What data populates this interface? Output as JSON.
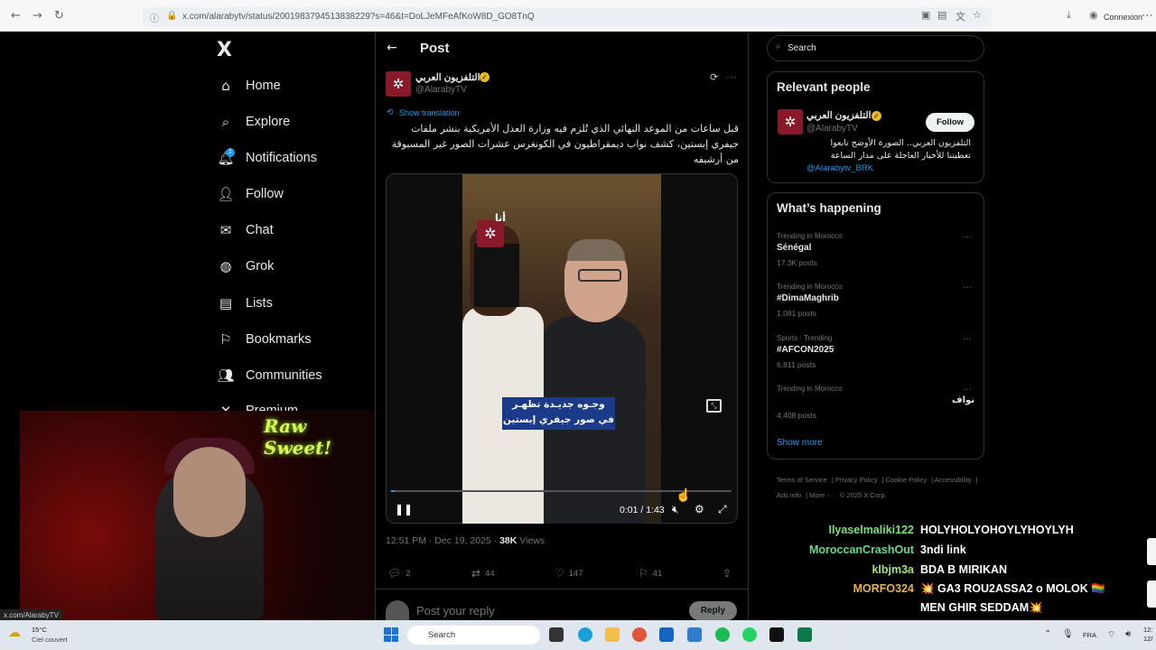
{
  "browser": {
    "url": "x.com/alarabytv/status/2001983794513838229?s=46&t=DoLJeMFeAfKoW8D_GO8TnQ",
    "connexion": "Connexion"
  },
  "nav": {
    "logo": "X",
    "items": [
      "Home",
      "Explore",
      "Notifications",
      "Follow",
      "Chat",
      "Grok",
      "Lists",
      "Bookmarks",
      "Communities",
      "Premium"
    ],
    "notif_badge": "1"
  },
  "webcam": {
    "sign_text": "Raw Sweet!",
    "status_url": "x.com/AlarabyTV"
  },
  "post": {
    "header_title": "Post",
    "author_name": "التلفزيون العربي",
    "author_handle": "@AlarabyTV",
    "show_translation": "Show translation",
    "text": "قبل ساعات من الموعد النهائي الذي تُلزم فيه وزارة العدل الأمريكية بنشر ملفات جيفري إبستين، كشف نواب ديمقراطيون في الكونغرس عشرات الصور غير المسبوقة من أرشيفه",
    "video": {
      "logo_tag": "أنا",
      "caption_line1": "وجـوه جديـدة تظهـر",
      "caption_line2": "في صور جيفري إبستين",
      "time": "0:01 / 1:43",
      "progress": 0.01
    },
    "timestamp": "12:51 PM · Dec 19, 2025 · ",
    "views_count": "38K",
    "views_label": " Views",
    "actions": {
      "replies": "2",
      "reposts": "44",
      "likes": "147",
      "bookmarks": "41"
    },
    "reply_placeholder": "Post your reply",
    "reply_button": "Reply"
  },
  "sidebar": {
    "search_placeholder": "Search",
    "relevant_title": "Relevant people",
    "relevant_name": "التلفزيون العربي",
    "relevant_handle": "@AlarabyTV",
    "follow_label": "Follow",
    "relevant_bio": "التلفزيون العربي.. الصورة الأوضح تابعوا تغطيتنا للأخبار العاجلة على مدار الساعة",
    "relevant_link": "@Alarabytv_BRK",
    "happening_title": "What’s happening",
    "trends": [
      {
        "context": "Trending in Morocco",
        "title": "Sénégal",
        "count": "17.3K posts"
      },
      {
        "context": "Trending in Morocco",
        "title": "#DimaMaghrib",
        "count": "1,081 posts"
      },
      {
        "context": "Sports · Trending",
        "title": "#AFCON2025",
        "count": "6,811 posts"
      },
      {
        "context": "Trending in Morocco",
        "title": "نواف",
        "count": "4,408 posts"
      }
    ],
    "show_more": "Show more",
    "footer": [
      "Terms of Service",
      "Privacy Policy",
      "Cookie Policy",
      "Accessibility",
      "Ads info",
      "More ···",
      "© 2025 X Corp."
    ]
  },
  "chat": [
    {
      "user": "Ilyaselmaliki122",
      "msg": "HOLYHOLYOHOYLYHOYLYH",
      "color": "#7ee07a"
    },
    {
      "user": "MoroccanCrashOut",
      "msg": "3ndi link",
      "color": "#66d98a"
    },
    {
      "user": "klbjm3a",
      "msg": "BDA B MIRIKAN",
      "color": "#a8e07a"
    },
    {
      "user": "MORFO324",
      "msg": "💥 GA3 ROU2ASSA2 o MOLOK 🏳️‍🌈",
      "color": "#e8b04a"
    },
    {
      "user": "",
      "msg": "MEN GHIR SEDDAM💥",
      "color": "#ffffff"
    }
  ],
  "taskbar": {
    "temp": "15°C",
    "weather": "Ciel couvert",
    "search": "Search",
    "lang": "FRA",
    "time": "12:",
    "date": "12/"
  },
  "colors": {
    "accent": "#1d9bf0",
    "bg": "#000000",
    "brand": "#8a1a2a"
  }
}
